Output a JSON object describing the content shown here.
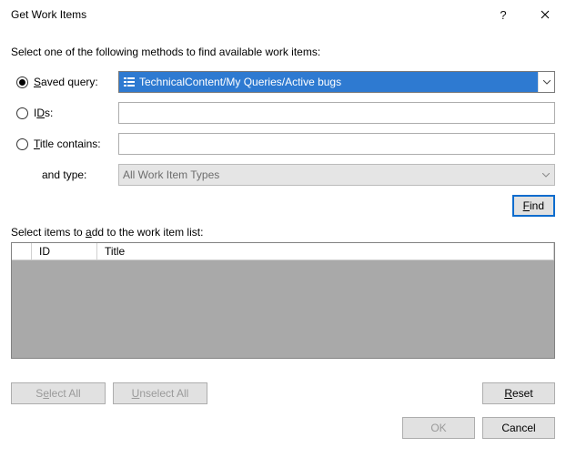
{
  "window": {
    "title": "Get Work Items"
  },
  "instruction": "Select one of the following methods to find available work items:",
  "methods": {
    "saved_query": {
      "label_pre": "",
      "label_u": "S",
      "label_post": "aved query:",
      "value": "TechnicalContent/My Queries/Active bugs",
      "checked": true
    },
    "ids": {
      "label_pre": "I",
      "label_u": "D",
      "label_post": "s:",
      "value": "",
      "checked": false
    },
    "title_contains": {
      "label_pre": "",
      "label_u": "T",
      "label_post": "itle contains:",
      "value": "",
      "checked": false
    },
    "and_type": {
      "label": "and type:",
      "value": "All Work Item Types"
    }
  },
  "buttons": {
    "find_u": "F",
    "find_post": "ind",
    "select_all_pre": "S",
    "select_all_u": "e",
    "select_all_post": "lect All",
    "unselect_all_pre": "",
    "unselect_all_u": "U",
    "unselect_all_post": "nselect All",
    "reset_pre": "",
    "reset_u": "R",
    "reset_post": "eset",
    "ok": "OK",
    "cancel": "Cancel"
  },
  "list": {
    "caption_pre": "Select items to ",
    "caption_u": "a",
    "caption_post": "dd to the work item list:",
    "columns": {
      "checkbox": "",
      "id": "ID",
      "title": "Title"
    }
  }
}
